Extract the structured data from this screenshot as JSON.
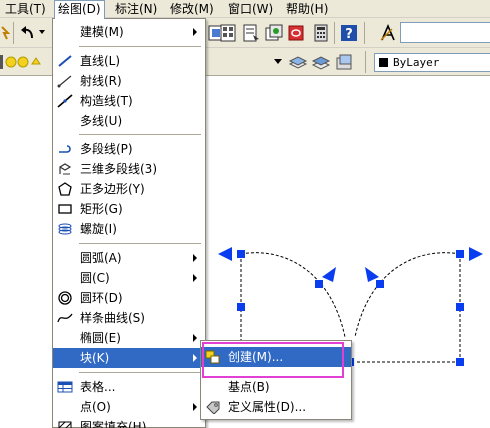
{
  "menubar": {
    "items": [
      {
        "label": "工具(T)"
      },
      {
        "label": "绘图(D)"
      },
      {
        "label": "标注(N)"
      },
      {
        "label": "修改(M)"
      },
      {
        "label": "窗口(W)"
      },
      {
        "label": "帮助(H)"
      }
    ]
  },
  "toolbar": {
    "layer_value": "ByLayer"
  },
  "draw_menu": {
    "items": [
      {
        "label": "建模(M)",
        "submenu": true
      },
      {
        "label": "直线(L)"
      },
      {
        "label": "射线(R)"
      },
      {
        "label": "构造线(T)"
      },
      {
        "label": "多线(U)"
      },
      {
        "label": "多段线(P)"
      },
      {
        "label": "三维多段线(3)"
      },
      {
        "label": "正多边形(Y)"
      },
      {
        "label": "矩形(G)"
      },
      {
        "label": "螺旋(I)"
      },
      {
        "label": "圆弧(A)",
        "submenu": true
      },
      {
        "label": "圆(C)",
        "submenu": true
      },
      {
        "label": "圆环(D)"
      },
      {
        "label": "样条曲线(S)"
      },
      {
        "label": "椭圆(E)",
        "submenu": true
      },
      {
        "label": "块(K)",
        "submenu": true,
        "highlighted": true
      },
      {
        "label": "表格..."
      },
      {
        "label": "点(O)",
        "submenu": true
      },
      {
        "label": "图案填充(H)..."
      }
    ]
  },
  "block_submenu": {
    "items": [
      {
        "label": "创建(M)...",
        "highlighted": true
      },
      {
        "label": "基点(B)"
      },
      {
        "label": "定义属性(D)..."
      }
    ]
  },
  "colors": {
    "highlight": "#316ac5",
    "annotation_box": "#e23fd4",
    "grip": "#0a3cf0"
  }
}
